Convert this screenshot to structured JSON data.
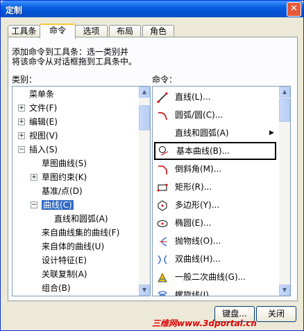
{
  "window": {
    "title": "定制",
    "close_glyph": "✕"
  },
  "tabs": [
    "工具条",
    "命令",
    "选项",
    "布局",
    "角色"
  ],
  "description": {
    "line1": "添加命令到工具条：选一类别并",
    "line2": "将该命令从对话框拖到工具条中。"
  },
  "labels": {
    "categories": "类别：",
    "commands": "命令："
  },
  "categories": [
    {
      "label": "菜单条",
      "expander": ""
    },
    {
      "label": "文件(F)",
      "expander": "+"
    },
    {
      "label": "编辑(E)",
      "expander": "+"
    },
    {
      "label": "视图(V)",
      "expander": "+"
    },
    {
      "label": "插入(S)",
      "expander": "−"
    },
    {
      "label": "草图曲线(S)",
      "expander": ""
    },
    {
      "label": "草图约束(K)",
      "expander": "+"
    },
    {
      "label": "基准/点(D)",
      "expander": ""
    },
    {
      "label": "曲线(C)",
      "expander": "−",
      "selected": true
    },
    {
      "label": "直线和圆弧(A)",
      "expander": ""
    },
    {
      "label": "来自曲线集的曲线(F)",
      "expander": ""
    },
    {
      "label": "来自体的曲线(U)",
      "expander": ""
    },
    {
      "label": "设计特征(E)",
      "expander": ""
    },
    {
      "label": "关联复制(A)",
      "expander": ""
    },
    {
      "label": "组合(B)",
      "expander": ""
    }
  ],
  "commands": [
    {
      "label": "直线(L)...",
      "icon": "line-icon"
    },
    {
      "label": "圆弧/圆(C)...",
      "icon": "arc-icon"
    },
    {
      "label": "直线和圆弧(A)",
      "icon": "",
      "submenu": "▶"
    },
    {
      "label": "基本曲线(B)...",
      "icon": "basic-curve-icon",
      "focused": true
    },
    {
      "label": "倒斜角(M)...",
      "icon": "chamfer-icon"
    },
    {
      "label": "矩形(R)...",
      "icon": "rectangle-icon"
    },
    {
      "label": "多边形(Y)...",
      "icon": "polygon-icon"
    },
    {
      "label": "椭圆(E)...",
      "icon": "ellipse-icon"
    },
    {
      "label": "抛物线(O)...",
      "icon": "parabola-icon"
    },
    {
      "label": "双曲线(H)...",
      "icon": "hyperbola-icon"
    },
    {
      "label": "一般二次曲线(G)...",
      "icon": "conic-icon"
    },
    {
      "label": "螺旋线(I)...",
      "icon": "helix-icon"
    }
  ],
  "buttons": {
    "keyboard": "键盘...",
    "close": "关闭"
  },
  "watermark": "三维网www.3dportal.cn"
}
